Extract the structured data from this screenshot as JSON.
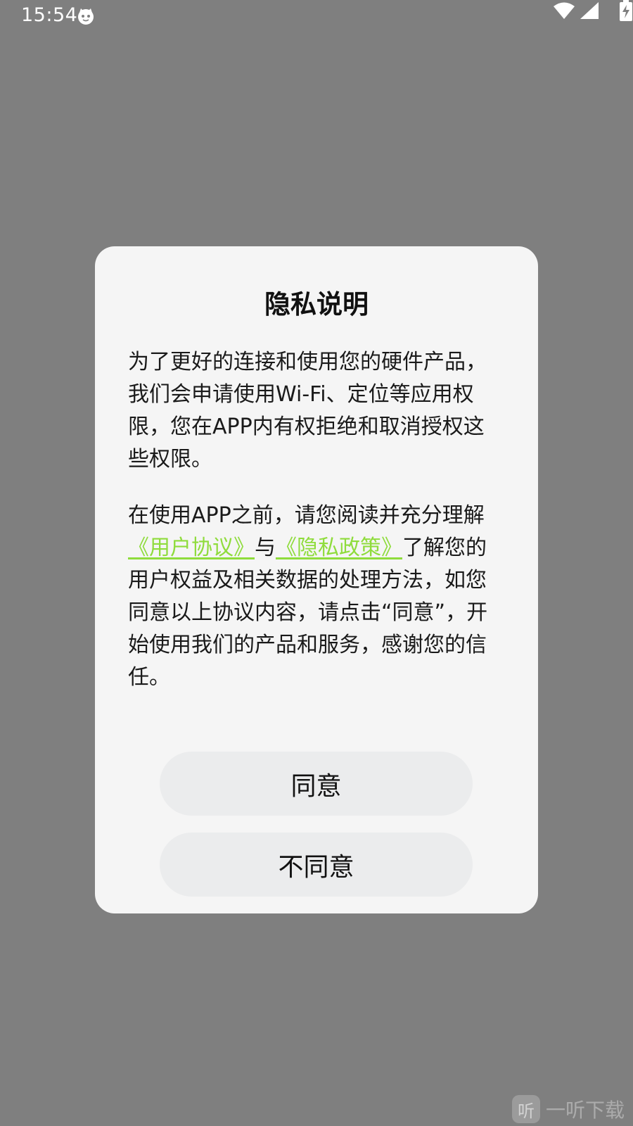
{
  "status_bar": {
    "time": "15:54",
    "app_icon": "cat-face-icon",
    "wifi_icon": "wifi-icon",
    "signal_icon": "cell-signal-icon",
    "battery_icon": "battery-charging-icon"
  },
  "dialog": {
    "title": "隐私说明",
    "paragraph1": "为了更好的连接和使用您的硬件产品，我们会申请使用Wi-Fi、定位等应用权限，您在APP内有权拒绝和取消授权这些权限。",
    "paragraph2": {
      "prefix": "在使用APP之前，请您阅读并充分理解",
      "link_user_agreement": "《用户协议》",
      "middle": "与",
      "link_privacy_policy": "《隐私政策》",
      "suffix": "了解您的用户权益及相关数据的处理方法，如您同意以上协议内容，请点击“同意”，开始使用我们的产品和服务，感谢您的信任。"
    },
    "agree_label": "同意",
    "disagree_label": "不同意"
  },
  "watermark": {
    "logo": "听",
    "text": "一听下载"
  },
  "colors": {
    "overlay": "#7f7f7f",
    "dialog_bg": "#f5f5f5",
    "link": "#8fdc3c",
    "button_bg": "#ebeced"
  }
}
